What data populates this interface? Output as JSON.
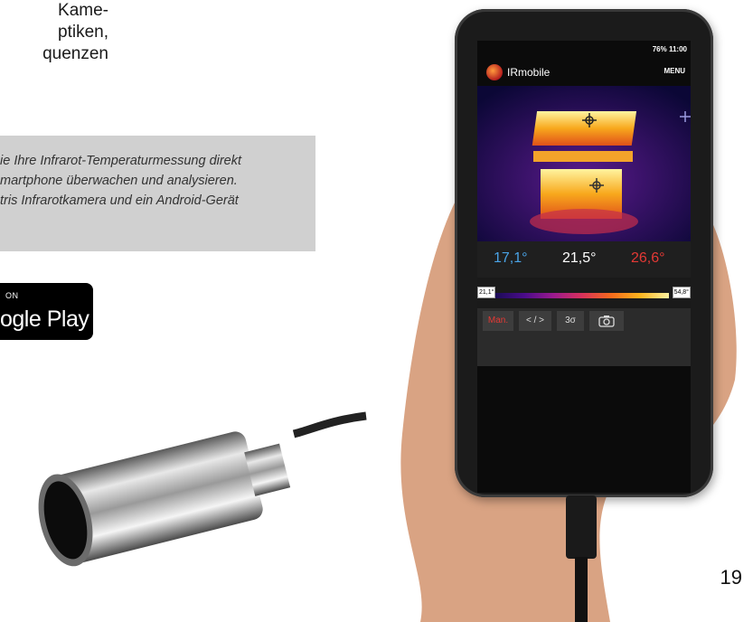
{
  "intro": {
    "lines": [
      "Kame-",
      "ptiken,",
      "quenzen"
    ]
  },
  "info_box": {
    "lines": [
      "ie Ihre Infrarot-Temperaturmessung direkt",
      "martphone überwachen und analysieren.",
      "tris Infrarotkamera und ein Android-Gerät"
    ]
  },
  "badge": {
    "small": "ON",
    "big": "ogle Play"
  },
  "page_number": "19",
  "phone": {
    "status": "76% 11:00",
    "app_title": "IRmobile",
    "menu_label": "MENU",
    "readouts": {
      "min": "17,1°",
      "center": "21,5°",
      "max": "26,6°"
    },
    "readout_colors": {
      "min": "#4aa3e6",
      "center": "#ffffff",
      "max": "#e53935"
    },
    "scale": {
      "low": "21,1°",
      "high": "54,8°"
    },
    "buttons": {
      "mode": "Man.",
      "range": "< / >",
      "sigma": "3σ",
      "camera": "camera-icon"
    }
  }
}
